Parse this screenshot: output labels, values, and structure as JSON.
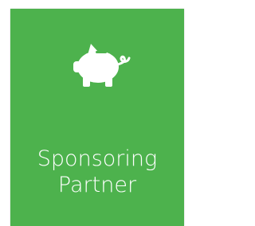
{
  "tile": {
    "line1": "Sponsoring",
    "line2": "Partner",
    "icon": "piggy-bank-icon",
    "background": "#4db24d",
    "text_color": "#ffffff"
  }
}
